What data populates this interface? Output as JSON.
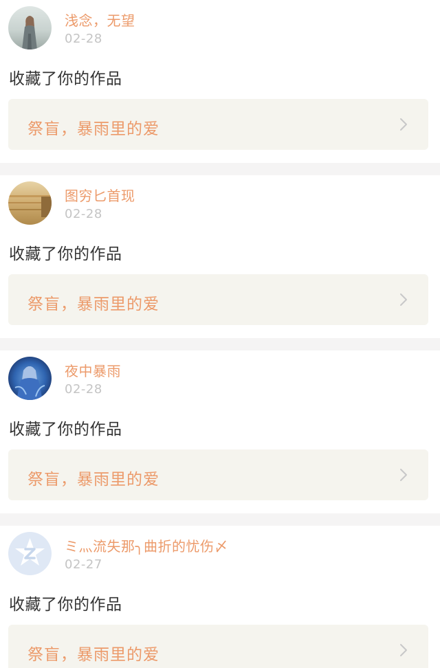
{
  "feed": {
    "items": [
      {
        "username": "浅念，无望",
        "date": "02-28",
        "action": "收藏了你的作品",
        "work_title": "祭盲，暴雨里的爱",
        "avatar_icon": "avatar-girl-sea"
      },
      {
        "username": "图穷匕首现",
        "date": "02-28",
        "action": "收藏了你的作品",
        "work_title": "祭盲，暴雨里的爱",
        "avatar_icon": "avatar-field"
      },
      {
        "username": "夜中暴雨",
        "date": "02-28",
        "action": "收藏了你的作品",
        "work_title": "祭盲，暴雨里的爱",
        "avatar_icon": "avatar-anime-blue"
      },
      {
        "username": "ミ灬流失那╮曲折的忧伤〆",
        "date": "02-27",
        "action": "收藏了你的作品",
        "work_title": "祭盲，暴雨里的爱",
        "avatar_icon": "avatar-default-z"
      }
    ]
  },
  "colors": {
    "accent": "#ec9a6a",
    "date_gray": "#c4c4c4",
    "text_dark": "#333333",
    "link_bg": "#f5f4ee",
    "separator": "#f5f4f4"
  }
}
